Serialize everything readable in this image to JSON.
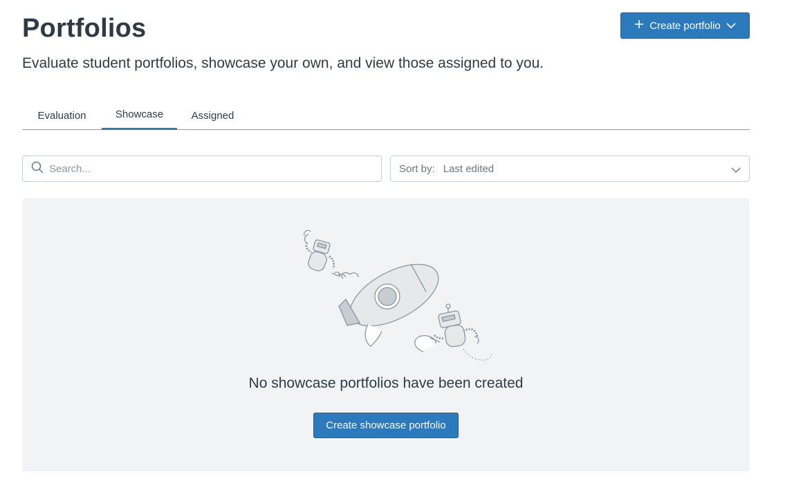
{
  "header": {
    "title": "Portfolios",
    "subtitle": "Evaluate student portfolios, showcase your own, and view those assigned to you.",
    "create_button_label": "Create portfolio"
  },
  "tabs": [
    {
      "label": "Evaluation",
      "active": false
    },
    {
      "label": "Showcase",
      "active": true
    },
    {
      "label": "Assigned",
      "active": false
    }
  ],
  "filters": {
    "search_placeholder": "Search...",
    "search_value": "",
    "sort_label": "Sort by:",
    "sort_value": "Last edited"
  },
  "empty_state": {
    "message": "No showcase portfolios have been created",
    "button_label": "Create showcase portfolio"
  },
  "colors": {
    "primary": "#2b7abc",
    "text": "#2d3b45",
    "panel_background": "#f2f3f4",
    "border": "#c7cdd1"
  },
  "icons": {
    "create_plus": "plus-icon",
    "create_dropdown": "chevron-down-icon",
    "search": "search-icon",
    "sort_dropdown": "chevron-down-icon"
  }
}
